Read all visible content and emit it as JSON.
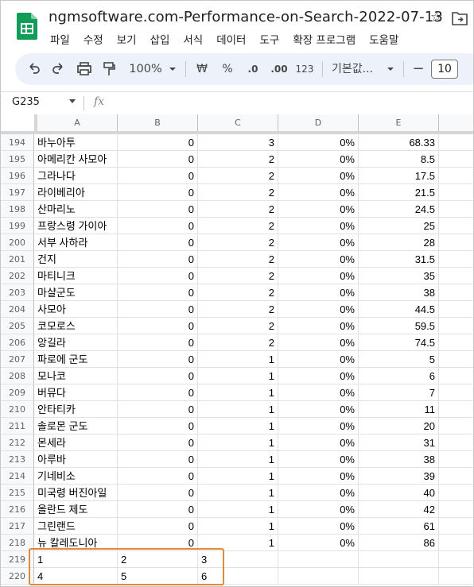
{
  "title": "ngmsoftware.com-Performance-on-Search-2022-07-13",
  "menu": [
    "파일",
    "수정",
    "보기",
    "삽입",
    "서식",
    "데이터",
    "도구",
    "확장 프로그램",
    "도움말"
  ],
  "toolbar": {
    "zoom": "100%",
    "currency": "₩",
    "percent": "%",
    "dec_decrease": ".0",
    "dec_increase": ".00",
    "number_format": "123",
    "font": "기본값...",
    "minus": "−",
    "font_size": "10"
  },
  "formula_bar": {
    "namebox": "G235",
    "fx": "fx"
  },
  "columns": [
    "A",
    "B",
    "C",
    "D",
    "E"
  ],
  "rows": [
    {
      "n": "194",
      "a": "바누아투",
      "b": "0",
      "c": "3",
      "d": "0%",
      "e": "68.33"
    },
    {
      "n": "195",
      "a": "아메리칸 사모아",
      "b": "0",
      "c": "2",
      "d": "0%",
      "e": "8.5"
    },
    {
      "n": "196",
      "a": "그라나다",
      "b": "0",
      "c": "2",
      "d": "0%",
      "e": "17.5"
    },
    {
      "n": "197",
      "a": "라이베리아",
      "b": "0",
      "c": "2",
      "d": "0%",
      "e": "21.5"
    },
    {
      "n": "198",
      "a": "산마리노",
      "b": "0",
      "c": "2",
      "d": "0%",
      "e": "24.5"
    },
    {
      "n": "199",
      "a": "프랑스령 가이아",
      "b": "0",
      "c": "2",
      "d": "0%",
      "e": "25"
    },
    {
      "n": "200",
      "a": "서부 사하라",
      "b": "0",
      "c": "2",
      "d": "0%",
      "e": "28"
    },
    {
      "n": "201",
      "a": "건지",
      "b": "0",
      "c": "2",
      "d": "0%",
      "e": "31.5"
    },
    {
      "n": "202",
      "a": "마티니크",
      "b": "0",
      "c": "2",
      "d": "0%",
      "e": "35"
    },
    {
      "n": "203",
      "a": "마샬군도",
      "b": "0",
      "c": "2",
      "d": "0%",
      "e": "38"
    },
    {
      "n": "204",
      "a": "사모아",
      "b": "0",
      "c": "2",
      "d": "0%",
      "e": "44.5"
    },
    {
      "n": "205",
      "a": "코모로스",
      "b": "0",
      "c": "2",
      "d": "0%",
      "e": "59.5"
    },
    {
      "n": "206",
      "a": "앙길라",
      "b": "0",
      "c": "2",
      "d": "0%",
      "e": "74.5"
    },
    {
      "n": "207",
      "a": "파로에 군도",
      "b": "0",
      "c": "1",
      "d": "0%",
      "e": "5"
    },
    {
      "n": "208",
      "a": "모나코",
      "b": "0",
      "c": "1",
      "d": "0%",
      "e": "6"
    },
    {
      "n": "209",
      "a": "버뮤다",
      "b": "0",
      "c": "1",
      "d": "0%",
      "e": "7"
    },
    {
      "n": "210",
      "a": "안타티카",
      "b": "0",
      "c": "1",
      "d": "0%",
      "e": "11"
    },
    {
      "n": "211",
      "a": "솔로몬 군도",
      "b": "0",
      "c": "1",
      "d": "0%",
      "e": "20"
    },
    {
      "n": "212",
      "a": "몬세라",
      "b": "0",
      "c": "1",
      "d": "0%",
      "e": "31"
    },
    {
      "n": "213",
      "a": "아루바",
      "b": "0",
      "c": "1",
      "d": "0%",
      "e": "38"
    },
    {
      "n": "214",
      "a": "기네비소",
      "b": "0",
      "c": "1",
      "d": "0%",
      "e": "39"
    },
    {
      "n": "215",
      "a": "미국령 버진아일",
      "b": "0",
      "c": "1",
      "d": "0%",
      "e": "40"
    },
    {
      "n": "216",
      "a": "올란드 제도",
      "b": "0",
      "c": "1",
      "d": "0%",
      "e": "42"
    },
    {
      "n": "217",
      "a": "그린랜드",
      "b": "0",
      "c": "1",
      "d": "0%",
      "e": "61"
    },
    {
      "n": "218",
      "a": "뉴 칼레도니아",
      "b": "0",
      "c": "1",
      "d": "0%",
      "e": "86"
    },
    {
      "n": "219",
      "a": "1",
      "b": "2",
      "c": "3",
      "d": "",
      "e": ""
    },
    {
      "n": "220",
      "a": "4",
      "b": "5",
      "c": "6",
      "d": "",
      "e": ""
    }
  ],
  "colors": {
    "toolbar_bg": "#edf2fa",
    "header_bg": "#f8f9fa",
    "highlight": "#e08a3c",
    "sheets_green": "#0f9d58"
  }
}
